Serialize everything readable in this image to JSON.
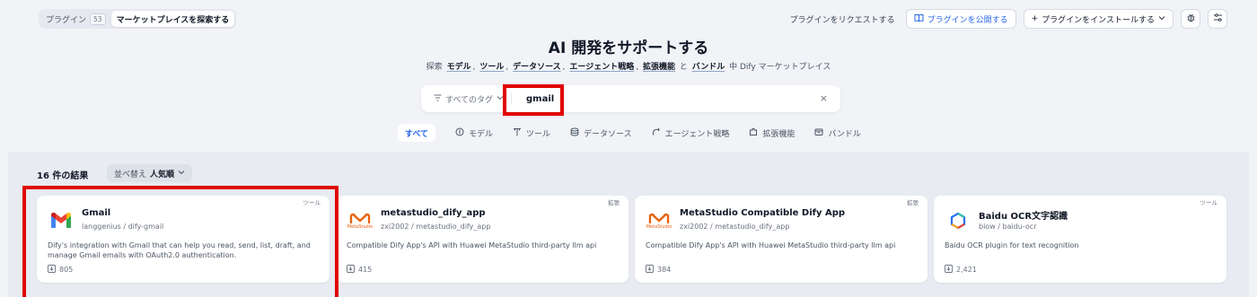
{
  "topbar": {
    "tabs": [
      {
        "label": "プラグイン",
        "count": "53"
      },
      {
        "label": "マーケットプレイスを探索する"
      }
    ],
    "request_label": "プラグインをリクエストする",
    "publish_label": "プラグインを公開する",
    "install_label": "プラグインをインストールする",
    "icons": [
      "bug-icon",
      "settings-sliders-icon"
    ]
  },
  "hero": {
    "title": "AI 開発をサポートする",
    "sub_prefix": "探索",
    "keywords": [
      "モデル",
      "ツール",
      "データソース",
      "エージェント戦略",
      "拡張機能"
    ],
    "and_word": "と",
    "last_keyword": "バンドル",
    "sub_suffix": "中 Dify マーケットプレイス"
  },
  "search": {
    "tag_label": "すべてのタグ",
    "value": "gmail",
    "clear": "×"
  },
  "categories": [
    {
      "label": "すべて",
      "icon": ""
    },
    {
      "label": "モデル",
      "icon": "model-icon"
    },
    {
      "label": "ツール",
      "icon": "tool-icon"
    },
    {
      "label": "データソース",
      "icon": "database-icon"
    },
    {
      "label": "エージェント戦略",
      "icon": "agent-icon"
    },
    {
      "label": "拡張機能",
      "icon": "extension-icon"
    },
    {
      "label": "バンドル",
      "icon": "bundle-icon"
    }
  ],
  "results": {
    "count_label": "16 件の結果",
    "sort_prefix": "並べ替え",
    "sort_value": "人気順"
  },
  "cards": [
    {
      "tag": "ツール",
      "name": "Gmail",
      "org": "langgenius / dify-gmail",
      "desc": "Dify's integration with Gmail that can help you read, send, list, draft, and manage Gmail emails with OAuth2.0 authentication.",
      "installs": "805",
      "icon": "gmail-icon"
    },
    {
      "tag": "拡張",
      "name": "metastudio_dify_app",
      "org": "zxi2002 / metastudio_dify_app",
      "desc": "Compatible Dify App's API with Huawei MetaStudio third-party llm api",
      "installs": "415",
      "icon": "metastudio-icon",
      "icon_text": "MetaStudio"
    },
    {
      "tag": "拡張",
      "name": "MetaStudio Compatible Dify App",
      "org": "zxi2002 / metastudio_dify_app",
      "desc": "Compatible Dify App's API with Huawei MetaStudio third-party llm api",
      "installs": "384",
      "icon": "metastudio-icon",
      "icon_text": "MetaStudio"
    },
    {
      "tag": "ツール",
      "name": "Baidu OCR文字認識",
      "org": "biow / baidu-ocr",
      "desc": "Baidu OCR plugin for text recognition",
      "installs": "2,421",
      "icon": "baidu-ocr-icon"
    }
  ],
  "colors": {
    "accent": "#2563eb",
    "highlight": "#e00000",
    "background": "#f1f3f7"
  }
}
